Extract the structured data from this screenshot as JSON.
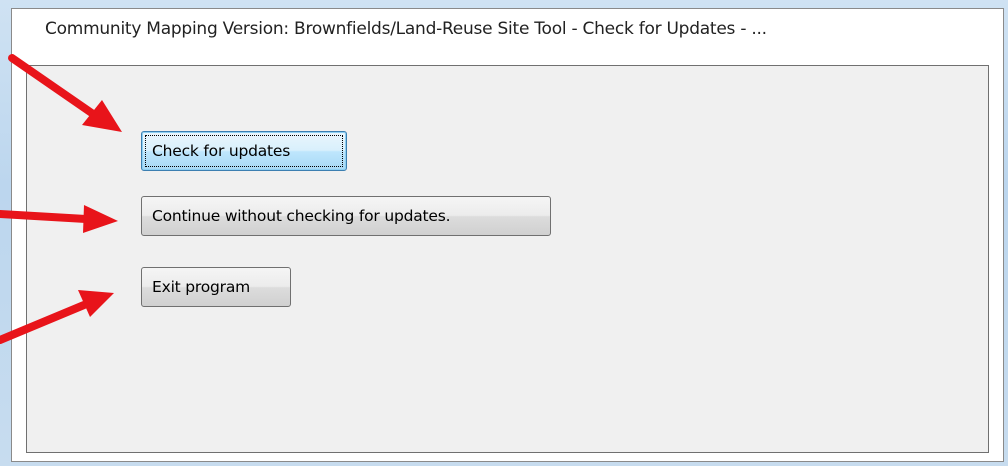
{
  "window": {
    "title": "Community Mapping Version: Brownfields/Land-Reuse Site Tool - Check for Updates - ..."
  },
  "buttons": {
    "check_label": "Check for updates",
    "continue_label": "Continue without checking for updates.",
    "exit_label": "Exit program"
  },
  "colors": {
    "annotation_arrow": "#e8141a",
    "default_button_border": "#3c7fb1",
    "client_background": "#f0f0f0"
  },
  "annotations": {
    "arrow_icon": "red-arrow-icon",
    "count": 3
  }
}
